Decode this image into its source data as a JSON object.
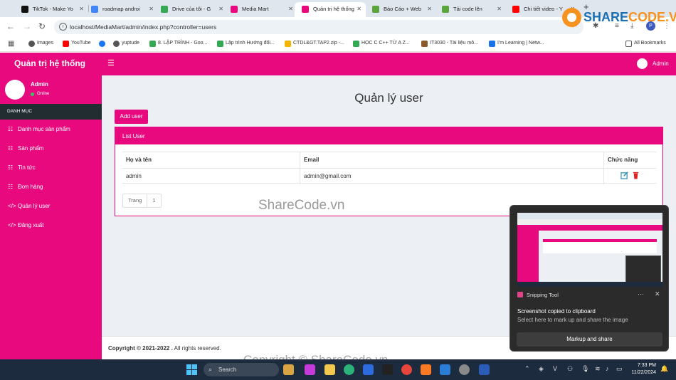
{
  "browser": {
    "tabs": [
      {
        "label": "TikTok - Make Yo",
        "color": "#111111"
      },
      {
        "label": "roadmap androi",
        "color": "#4285f4"
      },
      {
        "label": "Drive của tôi - G",
        "color": "#34a853"
      },
      {
        "label": "Media Mart",
        "color": "#e8097e"
      },
      {
        "label": "Quản trị hệ thống",
        "color": "#e8097e",
        "active": true
      },
      {
        "label": "Báo Cáo + Web",
        "color": "#5ba63a"
      },
      {
        "label": "Tải code lên",
        "color": "#5ba63a"
      },
      {
        "label": "Chi tiết video - Y",
        "color": "#ff0000"
      }
    ],
    "url": "localhost/MediaMart/admin/index.php?controller=users",
    "profile_letter": "P",
    "bookmarks": [
      {
        "label": "Images",
        "color": "#555555"
      },
      {
        "label": "YouTube",
        "color": "#ff0000"
      },
      {
        "label": "",
        "color": "#1877f2"
      },
      {
        "label": "yuptude",
        "color": "#555555"
      },
      {
        "label": "8. LẬP TRÌNH - Goo...",
        "color": "#34a853"
      },
      {
        "label": "Lập trình Hướng đối...",
        "color": "#34a853"
      },
      {
        "label": "CTDL&GT.TAP2.zip -...",
        "color": "#f4b400"
      },
      {
        "label": "HỌC C C++ TỪ A Z...",
        "color": "#34a853"
      },
      {
        "label": "IT3030 - Tài liệu mô...",
        "color": "#8b5a2b"
      },
      {
        "label": "I'm Learning | Netw...",
        "color": "#1a73e8"
      }
    ],
    "all_bookmarks": "All Bookmarks"
  },
  "app": {
    "brand": "Quản trị hệ thống",
    "header_user": "Admin",
    "sidebar_user": {
      "name": "Admin",
      "status": "Online"
    },
    "menu_heading": "DANH MỤC",
    "menu": [
      {
        "label": "Danh mục sản phẩm",
        "icon": "list-icon"
      },
      {
        "label": "Sản phẩm",
        "icon": "list-icon"
      },
      {
        "label": "Tin tức",
        "icon": "list-icon"
      },
      {
        "label": "Đơn hàng",
        "icon": "list-icon"
      },
      {
        "label": "Quản lý user",
        "icon": "code-icon"
      },
      {
        "label": "Đăng xuất",
        "icon": "code-icon"
      }
    ],
    "accent_color": "#e8097e"
  },
  "main": {
    "title": "Quản lý user",
    "add_button": "Add user",
    "box_title": "List User",
    "columns": [
      "Họ và tên",
      "Email",
      "Chức năng"
    ],
    "rows": [
      {
        "name": "admin",
        "email": "admin@gmail.com"
      }
    ],
    "pagination": {
      "label": "Trang",
      "pages": [
        "1"
      ]
    }
  },
  "footer": {
    "copyright": "Copyright © 2021-2022 .",
    "rest": " All rights reserved."
  },
  "watermarks": {
    "center": "ShareCode.vn",
    "bottom": "Copyright © ShareCode.vn",
    "logo_a": "SHARE",
    "logo_b": "CODE.VN"
  },
  "toast": {
    "app": "Snipping Tool",
    "title": "Screenshot copied to clipboard",
    "subtitle": "Select here to mark up and share the image",
    "button": "Markup and share"
  },
  "taskbar": {
    "search": "Search",
    "time": "7:33 PM",
    "date": "11/22/2024"
  }
}
